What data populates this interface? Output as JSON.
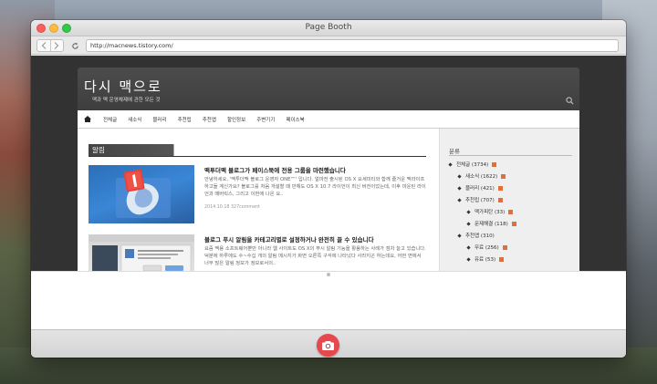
{
  "window": {
    "title": "Page Booth"
  },
  "toolbar": {
    "url": "http://macnews.tistory.com/"
  },
  "blog": {
    "title": "다시 맥으로",
    "subtitle": "맥과 맥 운영체제에 관한 모든 것"
  },
  "menu": {
    "items": [
      "전체글",
      "새소식",
      "블러리",
      "추천립",
      "추천앱",
      "할인정보",
      "주변기기",
      "페이스북"
    ]
  },
  "section": {
    "label": "알림"
  },
  "posts": [
    {
      "title": "맥투더맥 블로그가 페이스북에 전용 그룹을 마련했습니다",
      "excerpt": "안녕하세요, '맥투더맥 블로그 운영자 ONE™' 입니다. 얼마전 출시된 OS X 요세미티와 함께 즐거운 맥라이프 하고들 계신가요? 블로그를 처음 개설할 때 만해도 OS X 10.7 라이언이 최신 버전이었는데, 이후 마운틴 라이언과 매버릭스, 그리고 이번에 나온 요..",
      "meta": "2014.10.18  327comment"
    },
    {
      "title": "블로그 푸시 알림을 카테고리별로 설정하거나 완전히 끌 수 있습니다",
      "excerpt": "요즘 맥용 소프트웨어뿐만 아니라 웹 사이트도 OS X의 푸시 알림 기능을 활용하는 사례가 점차 늘고 있습니다. 덕분에 하루에도 수~수십 개의 알림 메시지가 화면 오른쪽 구석에 나타났다 사라지곤 하는데요, 어떤 면에서 너무 많은 알림 정보가 정보로서의.."
    }
  ],
  "sidebar": {
    "title": "분류",
    "categories": [
      {
        "label": "전체글 (3734)",
        "level": 0
      },
      {
        "label": "새소식 (1622)",
        "level": 1
      },
      {
        "label": "블러리 (421)",
        "level": 1
      },
      {
        "label": "추천립 (707)",
        "level": 1
      },
      {
        "label": "맥가피탄 (33)",
        "level": 2
      },
      {
        "label": "문제해결 (118)",
        "level": 2
      },
      {
        "label": "추천앱 (310)",
        "level": 1
      },
      {
        "label": "무료 (256)",
        "level": 2
      },
      {
        "label": "유료 (53)",
        "level": 2
      }
    ]
  },
  "colors": {
    "capture_button": "#e5484d",
    "header": "#444444",
    "new_badge": "#e0703a"
  },
  "icons": {
    "back": "chevron-left-icon",
    "forward": "chevron-right-icon",
    "reload": "reload-icon",
    "home": "home-icon",
    "search": "search-icon",
    "capture": "camera-icon"
  }
}
